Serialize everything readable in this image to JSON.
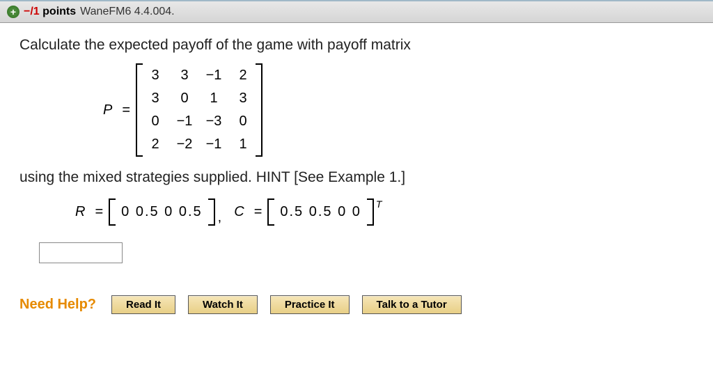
{
  "header": {
    "plus_glyph": "+",
    "points_neg": "−/1",
    "points_label": "points",
    "source": "WaneFM6 4.4.004."
  },
  "prompt": "Calculate the expected payoff of the game with payoff matrix",
  "matrix_P": {
    "label": "P",
    "eq": "=",
    "rows": [
      [
        "3",
        "3",
        "−1",
        "2"
      ],
      [
        "3",
        "0",
        "1",
        "3"
      ],
      [
        "0",
        "−1",
        "−3",
        "0"
      ],
      [
        "2",
        "−2",
        "−1",
        "1"
      ]
    ]
  },
  "hint_line": "using the mixed strategies supplied. HINT [See Example 1.]",
  "R": {
    "label": "R",
    "eq": "=",
    "values": "0  0.5  0  0.5"
  },
  "C": {
    "label": "C",
    "eq": "=",
    "values": "0.5  0.5  0  0",
    "transpose": "T"
  },
  "comma": ",",
  "answer_value": "",
  "help": {
    "need_help": "Need Help?",
    "read": "Read It",
    "watch": "Watch It",
    "practice": "Practice It",
    "tutor": "Talk to a Tutor"
  }
}
